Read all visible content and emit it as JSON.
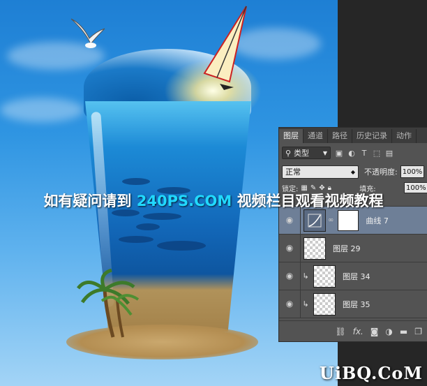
{
  "panel": {
    "tabs": [
      "图层",
      "通道",
      "路径",
      "历史记录",
      "动作"
    ],
    "active_tab": 0,
    "filter": {
      "label": "类型",
      "icons": [
        "image-filter-icon",
        "adjustment-filter-icon",
        "type-filter-icon",
        "shape-filter-icon",
        "smart-object-filter-icon"
      ]
    },
    "blend_mode": "正常",
    "opacity_label": "不透明度:",
    "opacity_value": "100%",
    "lock_label": "锁定:",
    "fill_label": "填充:",
    "fill_value": "100%",
    "layers": [
      {
        "name": "曲线 7",
        "type": "adjustment",
        "selected": true,
        "clipped": false
      },
      {
        "name": "图层 29",
        "type": "pixel",
        "selected": false,
        "clipped": false
      },
      {
        "name": "图层 34",
        "type": "pixel",
        "selected": false,
        "clipped": true
      },
      {
        "name": "图层 35",
        "type": "pixel",
        "selected": false,
        "clipped": true
      }
    ],
    "footer_icons": [
      "link-layers-icon",
      "fx-icon",
      "add-mask-icon",
      "adjustment-layer-icon",
      "new-group-icon",
      "new-layer-icon"
    ]
  },
  "watermark": {
    "prefix": "如有疑问请到",
    "site": "240PS.COM",
    "suffix": "视频栏目观看视频教程"
  },
  "logo": {
    "text": "UiBQ.CoM"
  },
  "colors": {
    "sky": "#2f95e2",
    "panel_bg": "#535353",
    "selected_row": "#6e7f97",
    "watermark_site": "#21d9ff"
  }
}
